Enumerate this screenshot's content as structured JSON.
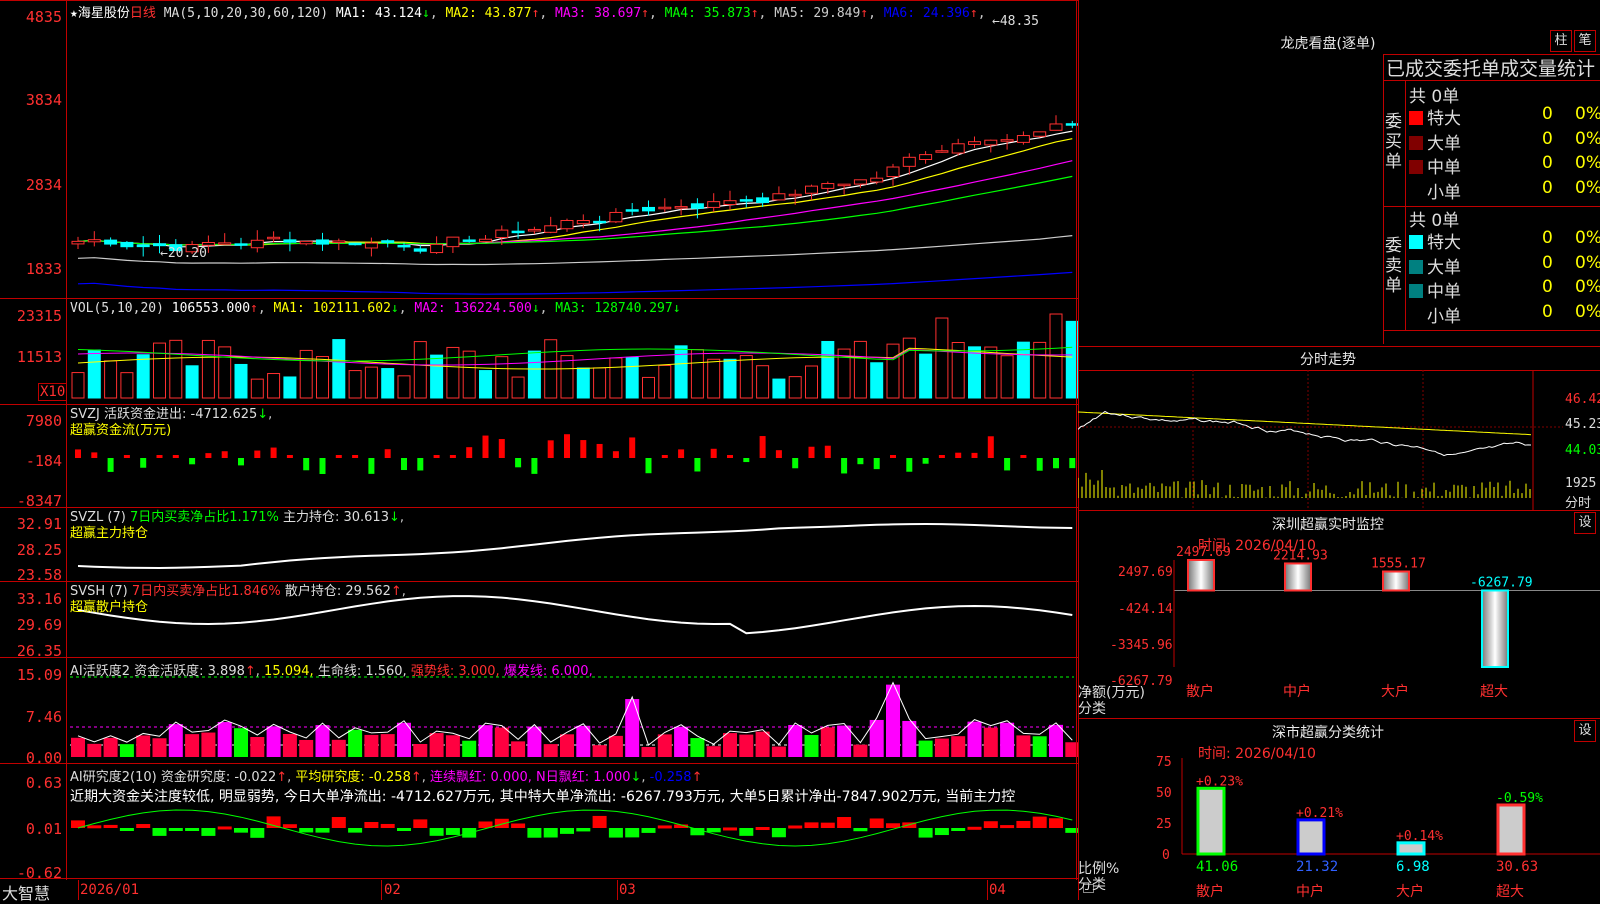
{
  "stock": {
    "star": "★",
    "name": "海星股份",
    "period": "日线"
  },
  "ma_legend": {
    "params": "MA(5,10,20,30,60,120)",
    "items": [
      {
        "label": "MA1:",
        "value": "43.124",
        "arrow": "↓",
        "color": "#ffffff"
      },
      {
        "label": "MA2:",
        "value": "43.877",
        "arrow": "↑",
        "color": "#ffff00"
      },
      {
        "label": "MA3:",
        "value": "38.697",
        "arrow": "↑",
        "color": "#ff00ff"
      },
      {
        "label": "MA4:",
        "value": "35.873",
        "arrow": "↑",
        "color": "#00ff00"
      },
      {
        "label": "MA5:",
        "value": "29.849",
        "arrow": "↑",
        "color": "#cccccc"
      },
      {
        "label": "MA6:",
        "value": "24.396",
        "arrow": "↑",
        "color": "#0000ff"
      }
    ],
    "high_mark": "48.35",
    "low_mark": "20.20"
  },
  "price_axis": [
    "4835",
    "3834",
    "2834",
    "1833"
  ],
  "vol": {
    "header": "VOL(5,10,20)",
    "value": "106553.000",
    "ma1": "MA1: 102111.602",
    "ma2": "MA2: 136224.500",
    "ma3": "MA3: 128740.297",
    "axis": [
      "23315",
      "11513"
    ],
    "unit": "X10"
  },
  "svzj": {
    "header": "SVZJ",
    "title": "活跃资金进出: -4712.625",
    "sub": "超赢资金流(万元)",
    "axis": [
      "7980",
      "-184",
      "-8347"
    ]
  },
  "svzl": {
    "header": "SVZL (7)",
    "pct": "7日内买卖净占比1.171%",
    "hold": "主力持仓: 30.613",
    "sub": "超赢主力持仓",
    "axis": [
      "32.91",
      "28.25",
      "23.58"
    ]
  },
  "svsh": {
    "header": "SVSH (7)",
    "pct": "7日内买卖净占比1.846%",
    "hold": "散户持仓: 29.562",
    "sub": "超赢散户持仓",
    "axis": [
      "33.16",
      "29.69",
      "26.35"
    ]
  },
  "ai2": {
    "header": "AI活跃度2",
    "a": "资金活跃度: 3.898",
    "b": "15.094,",
    "c": "生命线: 1.560,",
    "d": "强势线: 3.000,",
    "e": "爆发线: 6.000,",
    "axis": [
      "15.09",
      "7.46",
      "0.00"
    ]
  },
  "ai_research": {
    "header": "AI研究度2(10)",
    "a": "资金研究度: -0.022",
    "b": "平均研究度: -0.258",
    "c": "连续飘红: 0.000,",
    "d": "N日飘红: 1.000",
    "e": "-0.258",
    "text": "近期大资金关注度较低, 明显弱势, 今日大单净流出: -4712.627万元, 其中特大单净流出: -6267.793万元, 大单5日累计净出-7847.902万元, 当前主力控",
    "axis": [
      "0.63",
      "0.01",
      "-0.62"
    ]
  },
  "bottom": {
    "brand": "大智慧",
    "dates": [
      "2026/01",
      "02",
      "03",
      "04"
    ]
  },
  "lhb": {
    "title": "龙虎看盘(逐单)",
    "btn1": "柱",
    "btn2": "笔",
    "header": "已成交委托单成交量统计",
    "buy_label": "委买单",
    "sell_label": "委卖单",
    "buy_total": "共 0单",
    "sell_total": "共 0单",
    "buy_rows": [
      {
        "name": "特大",
        "qty": "0",
        "pct": "0%",
        "color": "#ff0000"
      },
      {
        "name": "大单",
        "qty": "0",
        "pct": "0%",
        "color": "#800000"
      },
      {
        "name": "中单",
        "qty": "0",
        "pct": "0%",
        "color": "#800000"
      },
      {
        "name": "小单",
        "qty": "0",
        "pct": "0%",
        "color": "#000000"
      }
    ],
    "sell_rows": [
      {
        "name": "特大",
        "qty": "0",
        "pct": "0%",
        "color": "#00ffff"
      },
      {
        "name": "大单",
        "qty": "0",
        "pct": "0%",
        "color": "#008080"
      },
      {
        "name": "中单",
        "qty": "0",
        "pct": "0%",
        "color": "#008080"
      },
      {
        "name": "小单",
        "qty": "0",
        "pct": "0%",
        "color": "#000000"
      }
    ]
  },
  "intraday": {
    "title": "分时走势",
    "axis": [
      "46.42",
      "45.23",
      "44.03"
    ],
    "vol_axis": "1925",
    "vol_label": "分时"
  },
  "sz_monitor": {
    "title": "深圳超赢实时监控",
    "btn": "设",
    "time": "时间: 2026/04/10",
    "axis": [
      "2497.69",
      "-424.14",
      "-3345.96",
      "-6267.79"
    ],
    "ylabel": "净额(万元)",
    "xlabel": "分类",
    "cats": [
      "散户",
      "中户",
      "大户",
      "超大"
    ],
    "values": [
      "2497.69",
      "2214.93",
      "1555.17",
      "-6267.79"
    ],
    "chart_data": {
      "type": "bar",
      "categories": [
        "散户",
        "中户",
        "大户",
        "超大"
      ],
      "values": [
        2497.69,
        2214.93,
        1555.17,
        -6267.79
      ],
      "ylabel": "净额(万元)",
      "xlabel": "分类",
      "ylim": [
        -6267.79,
        2497.69
      ]
    }
  },
  "sz_class": {
    "title": "深市超赢分类统计",
    "btn": "设",
    "time": "时间: 2026/04/10",
    "axis": [
      "75",
      "50",
      "25",
      "0"
    ],
    "ylabel": "比例%",
    "xlabel": "分类",
    "cats": [
      "散户",
      "中户",
      "大户",
      "超大"
    ],
    "values": [
      "41.06",
      "21.32",
      "6.98",
      "30.63"
    ],
    "changes": [
      "+0.23%",
      "+0.21%",
      "+0.14%",
      "-0.59%"
    ],
    "chart_data": {
      "type": "bar",
      "categories": [
        "散户",
        "中户",
        "大户",
        "超大"
      ],
      "values": [
        41.06,
        21.32,
        6.98,
        30.63
      ],
      "ylim": [
        0,
        75
      ],
      "ylabel": "比例%",
      "xlabel": "分类"
    }
  }
}
